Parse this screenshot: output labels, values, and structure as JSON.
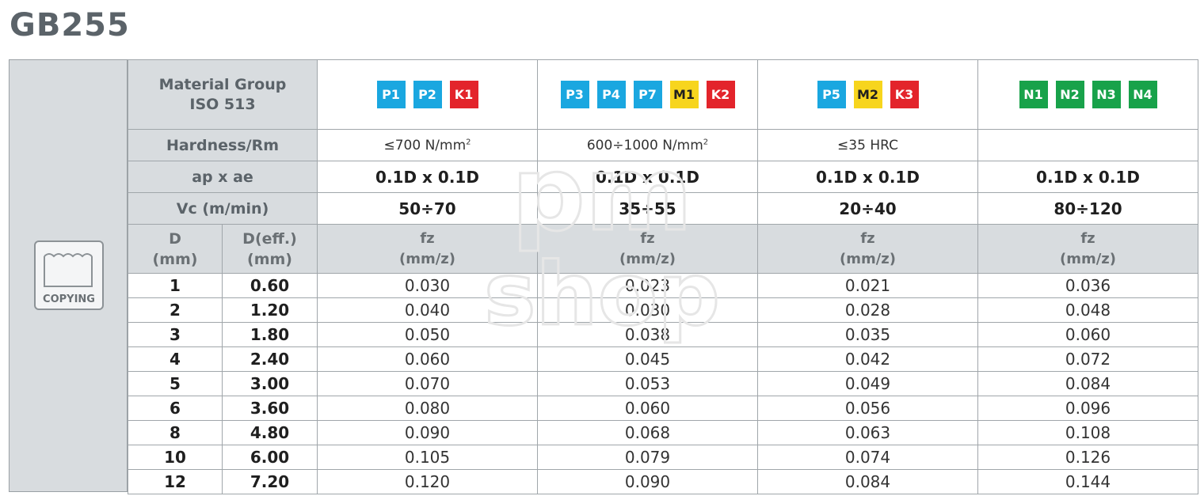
{
  "title": "GB255",
  "operation_icon": {
    "label": "COPYING"
  },
  "header": {
    "material_group_label_line1": "Material Group",
    "material_group_label_line2": "ISO 513",
    "hardness_label": "Hardness/Rm",
    "apae_label": "ap x ae",
    "vc_label": "Vc (m/min)",
    "d_label_line1": "D",
    "d_label_line2": "(mm)",
    "deff_label_line1": "D(eff.)",
    "deff_label_line2": "(mm)"
  },
  "groups": [
    {
      "badges": [
        {
          "text": "P1",
          "color": "#1aa7e0"
        },
        {
          "text": "P2",
          "color": "#1aa7e0"
        },
        {
          "text": "K1",
          "color": "#e3242b"
        }
      ],
      "hardness_main": "≤700 N/mm",
      "hardness_sup": "2",
      "apae": "0.1D x 0.1D",
      "vc": "50÷70",
      "fz_line1": "fz",
      "fz_line2": "(mm/z)"
    },
    {
      "badges": [
        {
          "text": "P3",
          "color": "#1aa7e0"
        },
        {
          "text": "P4",
          "color": "#1aa7e0"
        },
        {
          "text": "P7",
          "color": "#1aa7e0"
        },
        {
          "text": "M1",
          "color": "#f7d51d"
        },
        {
          "text": "K2",
          "color": "#e3242b"
        }
      ],
      "hardness_main": "600÷1000 N/mm",
      "hardness_sup": "2",
      "apae": "0.1D x 0.1D",
      "vc": "35÷55",
      "fz_line1": "fz",
      "fz_line2": "(mm/z)"
    },
    {
      "badges": [
        {
          "text": "P5",
          "color": "#1aa7e0"
        },
        {
          "text": "M2",
          "color": "#f7d51d"
        },
        {
          "text": "K3",
          "color": "#e3242b"
        }
      ],
      "hardness_main": "≤35 HRC",
      "hardness_sup": "",
      "apae": "0.1D x 0.1D",
      "vc": "20÷40",
      "fz_line1": "fz",
      "fz_line2": "(mm/z)"
    },
    {
      "badges": [
        {
          "text": "N1",
          "color": "#18a24a"
        },
        {
          "text": "N2",
          "color": "#18a24a"
        },
        {
          "text": "N3",
          "color": "#18a24a"
        },
        {
          "text": "N4",
          "color": "#18a24a"
        }
      ],
      "hardness_main": "",
      "hardness_sup": "",
      "apae": "0.1D x 0.1D",
      "vc": "80÷120",
      "fz_line1": "fz",
      "fz_line2": "(mm/z)"
    }
  ],
  "rows": [
    {
      "d": "1",
      "deff": "0.60",
      "fz": [
        "0.030",
        "0.023",
        "0.021",
        "0.036"
      ]
    },
    {
      "d": "2",
      "deff": "1.20",
      "fz": [
        "0.040",
        "0.030",
        "0.028",
        "0.048"
      ]
    },
    {
      "d": "3",
      "deff": "1.80",
      "fz": [
        "0.050",
        "0.038",
        "0.035",
        "0.060"
      ]
    },
    {
      "d": "4",
      "deff": "2.40",
      "fz": [
        "0.060",
        "0.045",
        "0.042",
        "0.072"
      ]
    },
    {
      "d": "5",
      "deff": "3.00",
      "fz": [
        "0.070",
        "0.053",
        "0.049",
        "0.084"
      ]
    },
    {
      "d": "6",
      "deff": "3.60",
      "fz": [
        "0.080",
        "0.060",
        "0.056",
        "0.096"
      ]
    },
    {
      "d": "8",
      "deff": "4.80",
      "fz": [
        "0.090",
        "0.068",
        "0.063",
        "0.108"
      ]
    },
    {
      "d": "10",
      "deff": "6.00",
      "fz": [
        "0.105",
        "0.079",
        "0.074",
        "0.126"
      ]
    },
    {
      "d": "12",
      "deff": "7.20",
      "fz": [
        "0.120",
        "0.090",
        "0.084",
        "0.144"
      ]
    }
  ],
  "watermark": {
    "line1": "pm",
    "line2": "shop"
  }
}
